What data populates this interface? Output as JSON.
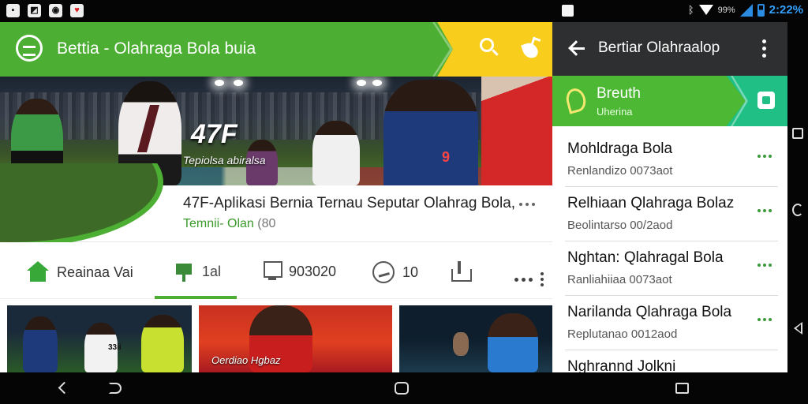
{
  "status_bar": {
    "left_icons": [
      "image-icon",
      "photo-icon",
      "camera-icon",
      "shield-icon"
    ],
    "battery_percent": "99%",
    "time": "2:22%"
  },
  "app": {
    "title": "Bettia - Olahraga Bola buia",
    "hero": {
      "overlay_big": "47F",
      "overlay_caption": "Tepiolsa abiralsa",
      "player_number": "9"
    },
    "article": {
      "title": "47F-Aplikasi Bernia Ternau Seputar Olahrag Bola,",
      "sub_green": "Temnii- Olan",
      "sub_tail": "(80"
    },
    "tabs": [
      {
        "label": "Reainaa Vai"
      },
      {
        "label": "1al"
      },
      {
        "label": "903020"
      },
      {
        "label": "10"
      },
      {
        "label": ""
      }
    ],
    "thumbs": {
      "t1_number": "33ii",
      "t2_caption": "Oerdiao Hgbaz"
    }
  },
  "panel": {
    "title": "Bertiar Olahraalop",
    "banner": {
      "title": "Breuth",
      "subtitle": "Uherina"
    },
    "items": [
      {
        "title": "Mohldraga Bola",
        "subtitle": "Renlandizo 0073aot"
      },
      {
        "title": "Relhiaan Qlahraga Bolaz",
        "subtitle": "Beolintarso 00/2aod"
      },
      {
        "title": "Nghtan: Qlahragal Bola",
        "subtitle": "Ranliahiiaa 0073aot"
      },
      {
        "title": "Narilanda Qlahraga Bola",
        "subtitle": "Replutanao 0012aod"
      },
      {
        "title": "Nghrannd Jolkni",
        "subtitle": ""
      }
    ]
  },
  "colors": {
    "brand_green": "#4caf34",
    "accent_yellow": "#f8cd1c",
    "teal": "#1fbf86",
    "time_blue": "#32a0ff"
  }
}
